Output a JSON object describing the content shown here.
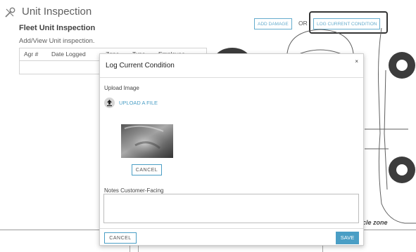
{
  "page": {
    "title": "Unit Inspection",
    "section_title": "Fleet Unit Inspection",
    "section_subtitle": "Add/View Unit inspection.",
    "icon": "tools-icon"
  },
  "table": {
    "columns": [
      "Agr #",
      "Date Logged",
      "Zone",
      "Type",
      "Employee"
    ]
  },
  "actions": {
    "add_damage": "ADD DAMAGE",
    "or_text": "OR",
    "log_condition": "LOG CURRENT CONDITION"
  },
  "diagram": {
    "zone_label": "cle zone"
  },
  "modal": {
    "title": "Log Current Condition",
    "close": "×",
    "upload_label": "Upload Image",
    "upload_link": "UPLOAD A FILE",
    "upload_icon": "upload-arrow-icon",
    "image_cancel": "CANCEL",
    "notes_label": "Notes Customer-Facing",
    "notes_value": "",
    "cancel": "CANCEL",
    "save": "SAVE"
  },
  "colors": {
    "accent": "#4a9ec5",
    "border": "#cccccc",
    "text": "#333333"
  }
}
